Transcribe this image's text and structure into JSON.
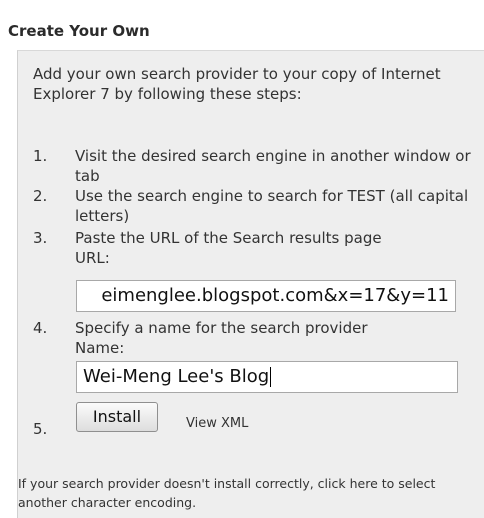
{
  "header": {
    "title": "Create Your Own"
  },
  "intro": {
    "text": "Add your own search provider to your copy of Internet Explorer 7 by following these steps:"
  },
  "steps": [
    {
      "num": "1.",
      "text": "Visit the desired search engine in another window or tab"
    },
    {
      "num": "2.",
      "text": "Use the search engine to search for TEST (all capital letters)"
    },
    {
      "num": "3.",
      "text": "Paste the URL of the Search results page"
    },
    {
      "num": "4.",
      "text": "Specify a name for the search provider"
    },
    {
      "num": "5."
    }
  ],
  "url_field": {
    "label": "URL:",
    "value": "eimenglee.blogspot.com&x=17&y=11"
  },
  "name_field": {
    "label": "Name:",
    "value": "Wei-Meng Lee's Blog"
  },
  "install_button": {
    "label": "Install"
  },
  "view_xml_link": {
    "label": "View XML"
  },
  "footer": {
    "text": "If your search provider doesn't install correctly, click here to select another character encoding."
  }
}
